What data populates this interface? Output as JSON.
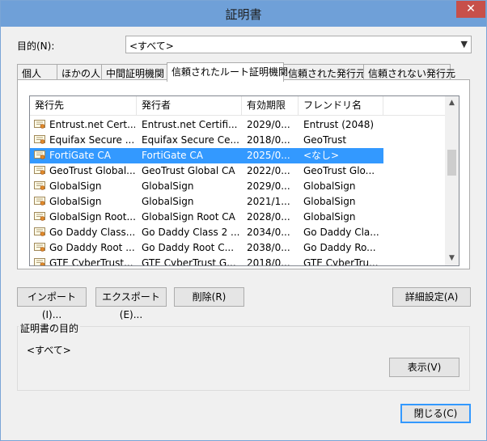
{
  "window": {
    "title": "証明書",
    "close_glyph": "✕"
  },
  "purpose": {
    "label": "目的(N):",
    "selected": "<すべて>"
  },
  "tabs": [
    {
      "label": "個人"
    },
    {
      "label": "ほかの人"
    },
    {
      "label": "中間証明機関"
    },
    {
      "label": "信頼されたルート証明機関"
    },
    {
      "label": "信頼された発行元"
    },
    {
      "label": "信頼されない発行元"
    }
  ],
  "list": {
    "columns": [
      "発行先",
      "発行者",
      "有効期限",
      "フレンドリ名"
    ],
    "rows": [
      {
        "issued_to": "Entrust.net Cert...",
        "issued_by": "Entrust.net Certifi...",
        "expires": "2029/0...",
        "friendly": "Entrust (2048)"
      },
      {
        "issued_to": "Equifax Secure ...",
        "issued_by": "Equifax Secure Ce...",
        "expires": "2018/0...",
        "friendly": "GeoTrust"
      },
      {
        "issued_to": "FortiGate CA",
        "issued_by": "FortiGate CA",
        "expires": "2025/0...",
        "friendly": "<なし>"
      },
      {
        "issued_to": "GeoTrust Global...",
        "issued_by": "GeoTrust Global CA",
        "expires": "2022/0...",
        "friendly": "GeoTrust Glo..."
      },
      {
        "issued_to": "GlobalSign",
        "issued_by": "GlobalSign",
        "expires": "2029/0...",
        "friendly": "GlobalSign"
      },
      {
        "issued_to": "GlobalSign",
        "issued_by": "GlobalSign",
        "expires": "2021/1...",
        "friendly": "GlobalSign"
      },
      {
        "issued_to": "GlobalSign Root...",
        "issued_by": "GlobalSign Root CA",
        "expires": "2028/0...",
        "friendly": "GlobalSign"
      },
      {
        "issued_to": "Go Daddy Class...",
        "issued_by": "Go Daddy Class 2 ...",
        "expires": "2034/0...",
        "friendly": "Go Daddy Cla..."
      },
      {
        "issued_to": "Go Daddy Root ...",
        "issued_by": "Go Daddy Root C...",
        "expires": "2038/0...",
        "friendly": "Go Daddy Ro..."
      },
      {
        "issued_to": "GTE CyberTrust...",
        "issued_by": "GTE CyberTrust G...",
        "expires": "2018/0...",
        "friendly": "GTE CyberTru..."
      }
    ],
    "selected_index": 2
  },
  "buttons": {
    "import": "インポート(I)...",
    "export": "エクスポート(E)...",
    "delete": "削除(R)",
    "advanced": "詳細設定(A)",
    "view": "表示(V)",
    "close": "閉じる(C)"
  },
  "purpose_group": {
    "label": "証明書の目的",
    "value": "<すべて>"
  },
  "colors": {
    "titlebar": "#6fa0d8",
    "selection": "#3399ff",
    "close": "#c7504a"
  }
}
